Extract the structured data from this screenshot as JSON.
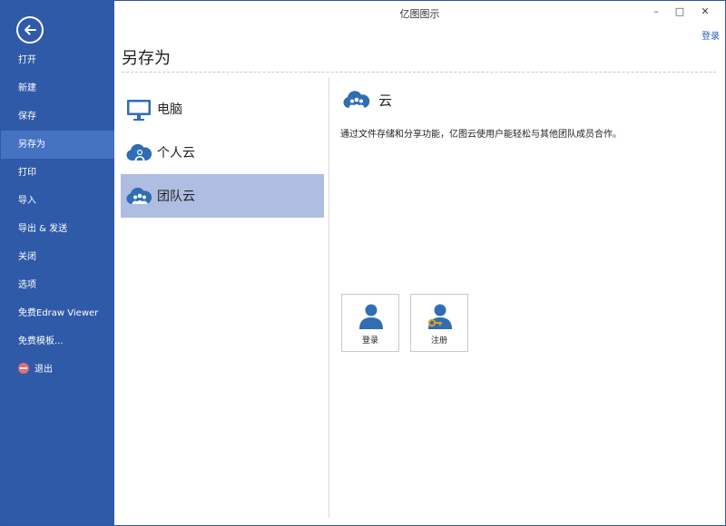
{
  "window": {
    "title": "亿图图示",
    "minimize_glyph": "–",
    "maximize_glyph": "□",
    "close_glyph": "✕",
    "login_link": "登录"
  },
  "sidebar": {
    "back_icon": "back-arrow-icon",
    "items": [
      {
        "label": "打开"
      },
      {
        "label": "新建"
      },
      {
        "label": "保存"
      },
      {
        "label": "另存为",
        "active": true
      },
      {
        "label": "打印"
      },
      {
        "label": "导入"
      },
      {
        "label": "导出 & 发送"
      },
      {
        "label": "关闭"
      },
      {
        "label": "选项"
      },
      {
        "label": "免费Edraw Viewer"
      },
      {
        "label": "免费模板..."
      },
      {
        "label": "退出",
        "icon": "exit-icon"
      }
    ]
  },
  "main": {
    "title": "另存为",
    "locations": [
      {
        "label": "电脑",
        "icon": "monitor-icon"
      },
      {
        "label": "个人云",
        "icon": "personal-cloud-icon"
      },
      {
        "label": "团队云",
        "icon": "team-cloud-icon",
        "selected": true
      }
    ],
    "cloud_panel": {
      "title": "云",
      "description": "通过文件存储和分享功能，亿图云使用户能轻松与其他团队成员合作。",
      "login_button": "登录",
      "register_button": "注册"
    }
  },
  "colors": {
    "sidebar_bg": "#2f5aa8",
    "sidebar_active": "#4672c4",
    "selected_location": "#aebde1",
    "icon_blue": "#2f6db5",
    "link": "#1f5fbf"
  }
}
